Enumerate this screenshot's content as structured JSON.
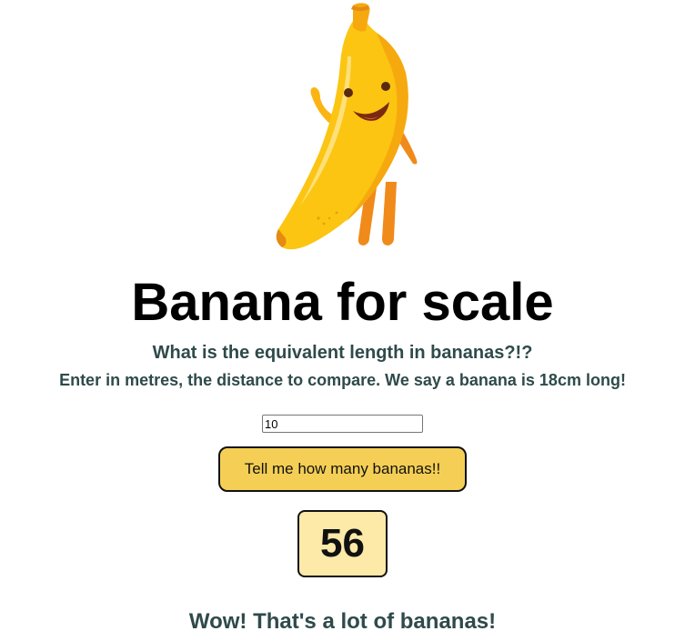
{
  "header": {
    "mascot_icon": "banana-mascot-icon",
    "title": "Banana for scale",
    "subtitle": "What is the equivalent length in bananas?!?",
    "instructions": "Enter in metres, the distance to compare. We say a banana is 18cm long!"
  },
  "form": {
    "distance_value": "10",
    "button_label": "Tell me how many bananas!!"
  },
  "result": {
    "count": "56",
    "comment": "Wow! That's a lot of bananas!"
  },
  "colors": {
    "button_bg": "#f5cf55",
    "result_bg": "#fde9a8",
    "subtitle_text": "#2f4a4a",
    "banana_yellow": "#fbc512",
    "banana_leg": "#f08a1a"
  }
}
